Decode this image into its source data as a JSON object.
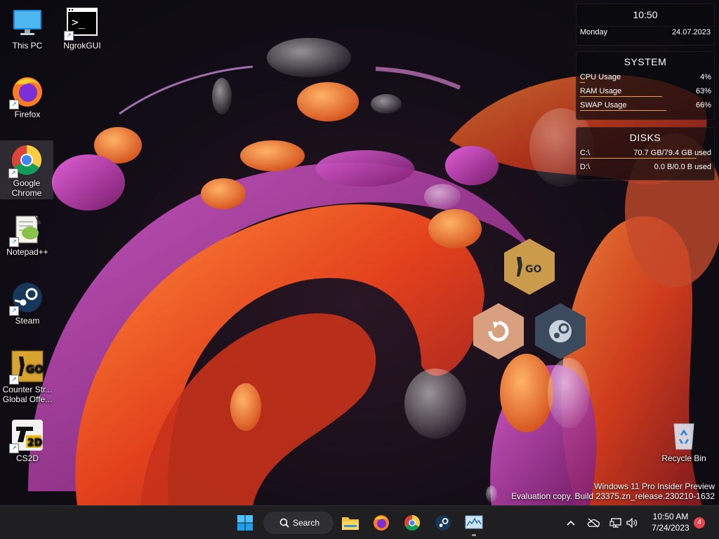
{
  "desktop": {
    "icons": [
      {
        "label": "This PC"
      },
      {
        "label": "NgrokGUI"
      },
      {
        "label": "Firefox"
      },
      {
        "label": "Google Chrome"
      },
      {
        "label": "Notepad++"
      },
      {
        "label": "Steam"
      },
      {
        "label": "Counter Str... Global Offe..."
      },
      {
        "label": "CS2D"
      },
      {
        "label": "Recycle Bin"
      }
    ]
  },
  "clock_widget": {
    "time": "10:50",
    "day": "Monday",
    "date": "24.07.2023"
  },
  "system_widget": {
    "title": "SYSTEM",
    "rows": [
      {
        "label": "CPU Usage",
        "value": "4%",
        "fraction": 0.04
      },
      {
        "label": "RAM Usage",
        "value": "63%",
        "fraction": 0.63
      },
      {
        "label": "SWAP Usage",
        "value": "66%",
        "fraction": 0.66
      }
    ]
  },
  "disks_widget": {
    "title": "DISKS",
    "rows": [
      {
        "label": "C:\\",
        "value": "70.7 GB/79.4 GB used",
        "fraction": 0.89
      },
      {
        "label": "D:\\",
        "value": "0.0 B/0.0 B used",
        "fraction": 0.0
      }
    ]
  },
  "hex_launcher": [
    {
      "name": "csgo",
      "text": "GO"
    },
    {
      "name": "refresh"
    },
    {
      "name": "steam"
    }
  ],
  "watermark": {
    "line1": "Windows 11 Pro Insider Preview",
    "line2": "Evaluation copy. Build 23375.zn_release.230210-1632"
  },
  "taskbar": {
    "search_label": "Search",
    "time": "10:50 AM",
    "date": "7/24/2023",
    "notification_count": "4"
  },
  "colors": {
    "accent": "#e8a23b",
    "taskbar": "#1f1f21",
    "badge": "#e8474c"
  }
}
